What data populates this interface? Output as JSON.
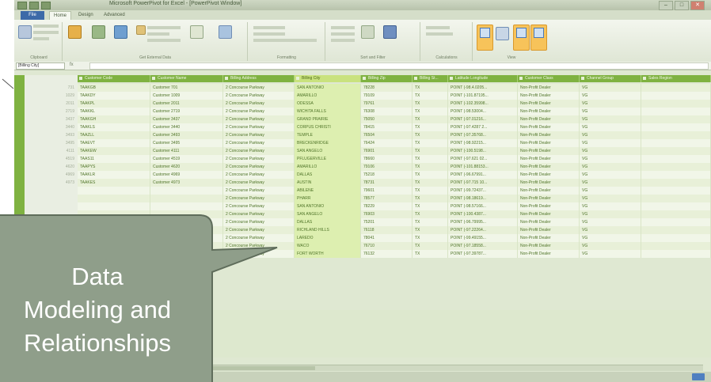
{
  "window": {
    "title": "Microsoft PowerPivot for Excel - [PowerPivot Window]",
    "tabs": [
      "Home",
      "Design",
      "Advanced"
    ],
    "file_tab": "File",
    "controls": [
      "–",
      "□",
      "✕"
    ]
  },
  "ribbon": {
    "groups": [
      "Clipboard",
      "Get External Data",
      "Formatting",
      "Sort and Filter",
      "Calculations",
      "View"
    ]
  },
  "formula_bar": {
    "name_box": "[Billing City]",
    "fx": "fx"
  },
  "table": {
    "columns": [
      {
        "label": "Customer Code",
        "width": 92
      },
      {
        "label": "Customer Name",
        "width": 92
      },
      {
        "label": "Billing Address",
        "width": 90
      },
      {
        "label": "Billing City",
        "width": 84,
        "highlight": true
      },
      {
        "label": "Billing Zip",
        "width": 65
      },
      {
        "label": "Billing St...",
        "width": 45
      },
      {
        "label": "Latitude Longitude",
        "width": 88
      },
      {
        "label": "Customer Class",
        "width": 78
      },
      {
        "label": "Channel Group",
        "width": 78
      },
      {
        "label": "Sales Region",
        "width": 88
      }
    ],
    "rows": [
      {
        "n": "731",
        "cells": [
          "TAAKGB",
          "Customer 701",
          "2 Concourse Parkway",
          "SAN ANTONIO",
          "78228",
          "TX",
          "POINT (-98.4.0205...",
          "Non-Profit Dealer",
          "VG",
          ""
        ]
      },
      {
        "n": "1029",
        "cells": [
          "TAAKDY",
          "Customer 1009",
          "2 Concourse Parkway",
          "AMARILLO",
          "79109",
          "TX",
          "POINT (-101.87195...",
          "Non-Profit Dealer",
          "VG",
          ""
        ]
      },
      {
        "n": "2011",
        "cells": [
          "TAAKPL",
          "Customer 2011",
          "2 Concourse Parkway",
          "ODESSA",
          "79761",
          "TX",
          "POINT (-102.35998...",
          "Non-Profit Dealer",
          "VG",
          ""
        ]
      },
      {
        "n": "2719",
        "cells": [
          "TAAKKL",
          "Customer 2719",
          "2 Concourse Parkway",
          "WICHITA FALLS",
          "76308",
          "TX",
          "POINT (-98.53004...",
          "Non-Profit Dealer",
          "VG",
          ""
        ]
      },
      {
        "n": "3437",
        "cells": [
          "TAAKGH",
          "Customer 3437",
          "2 Concourse Parkway",
          "GRAND PRAIRIE",
          "75050",
          "TX",
          "POINT (-97.01216...",
          "Non-Profit Dealer",
          "VG",
          ""
        ]
      },
      {
        "n": "3440",
        "cells": [
          "TAAKLS",
          "Customer 3440",
          "2 Concourse Parkway",
          "CORPUS CHRISTI",
          "78415",
          "TX",
          "POINT (-97.4287 2...",
          "Non-Profit Dealer",
          "VG",
          ""
        ]
      },
      {
        "n": "3493",
        "cells": [
          "TAAZLL",
          "Customer 3493",
          "2 Concourse Parkway",
          "TEMPLE",
          "76504",
          "TX",
          "POINT (-97.35768...",
          "Non-Profit Dealer",
          "VG",
          ""
        ]
      },
      {
        "n": "3495",
        "cells": [
          "TAAEVT",
          "Customer 3495",
          "2 Concourse Parkway",
          "BRECKENRIDGE",
          "76424",
          "TX",
          "POINT (-98.92215...",
          "Non-Profit Dealer",
          "VG",
          ""
        ]
      },
      {
        "n": "4111",
        "cells": [
          "TAAKEW",
          "Customer 4111",
          "2 Concourse Parkway",
          "SAN ANGELO",
          "76901",
          "TX",
          "POINT (-100.5198...",
          "Non-Profit Dealer",
          "VG",
          ""
        ]
      },
      {
        "n": "4519",
        "cells": [
          "TAAS11",
          "Customer 4519",
          "2 Concourse Parkway",
          "PFLUGERVILLE",
          "78660",
          "TX",
          "POINT (-97.621 02...",
          "Non-Profit Dealer",
          "VG",
          ""
        ]
      },
      {
        "n": "4620",
        "cells": [
          "TAAPYS",
          "Customer 4620",
          "2 Concourse Parkway",
          "AMARILLO",
          "79106",
          "TX",
          "POINT (-101.88153...",
          "Non-Profit Dealer",
          "VG",
          ""
        ]
      },
      {
        "n": "4969",
        "cells": [
          "TAAKLR",
          "Customer 4969",
          "2 Concourse Parkway",
          "DALLAS",
          "75218",
          "TX",
          "POINT (-96.67991...",
          "Non-Profit Dealer",
          "VG",
          ""
        ]
      },
      {
        "n": "4973",
        "cells": [
          "TAAKES",
          "Customer 4973",
          "2 Concourse Parkway",
          "AUSTIN",
          "78731",
          "TX",
          "POINT (-97.715 10...",
          "Non-Profit Dealer",
          "VG",
          ""
        ]
      },
      {
        "n": "",
        "cells": [
          "",
          "",
          "2 Concourse Parkway",
          "ABILENE",
          "79601",
          "TX",
          "POINT (-99.72437...",
          "Non-Profit Dealer",
          "VG",
          ""
        ]
      },
      {
        "n": "",
        "cells": [
          "",
          "",
          "2 Concourse Parkway",
          "PHARR",
          "78577",
          "TX",
          "POINT (-98.18619...",
          "Non-Profit Dealer",
          "VG",
          ""
        ]
      },
      {
        "n": "",
        "cells": [
          "",
          "",
          "2 Concourse Parkway",
          "SAN ANTONIO",
          "78229",
          "TX",
          "POINT (-98.57166...",
          "Non-Profit Dealer",
          "VG",
          ""
        ]
      },
      {
        "n": "",
        "cells": [
          "",
          "",
          "2 Concourse Parkway",
          "SAN ANGELO",
          "76903",
          "TX",
          "POINT (-100.4387...",
          "Non-Profit Dealer",
          "VG",
          ""
        ]
      },
      {
        "n": "",
        "cells": [
          "",
          "",
          "2 Concourse Parkway",
          "DALLAS",
          "75201",
          "TX",
          "POINT (-96.79995...",
          "Non-Profit Dealer",
          "VG",
          ""
        ]
      },
      {
        "n": "",
        "cells": [
          "",
          "",
          "2 Concourse Parkway",
          "RICHLAND HILLS",
          "76118",
          "TX",
          "POINT (-97.22264...",
          "Non-Profit Dealer",
          "VG",
          ""
        ]
      },
      {
        "n": "",
        "cells": [
          "",
          "",
          "2 Concourse Parkway",
          "LAREDO",
          "78041",
          "TX",
          "POINT (-99.49155...",
          "Non-Profit Dealer",
          "VG",
          ""
        ]
      },
      {
        "n": "",
        "cells": [
          "",
          "",
          "2 Concourse Parkway",
          "WACO",
          "76710",
          "TX",
          "POINT (-97.18558...",
          "Non-Profit Dealer",
          "VG",
          ""
        ]
      },
      {
        "n": "",
        "cells": [
          "",
          "",
          "2 Concourse Parkway",
          "FORT WORTH",
          "76132",
          "TX",
          "POINT (-97.39787...",
          "Non-Profit Dealer",
          "VG",
          ""
        ]
      }
    ]
  },
  "callout": {
    "lines": [
      "Data",
      "Modeling and",
      "Relationships"
    ],
    "fill": "#8f9e8a",
    "stroke": "#5f6d5b"
  }
}
